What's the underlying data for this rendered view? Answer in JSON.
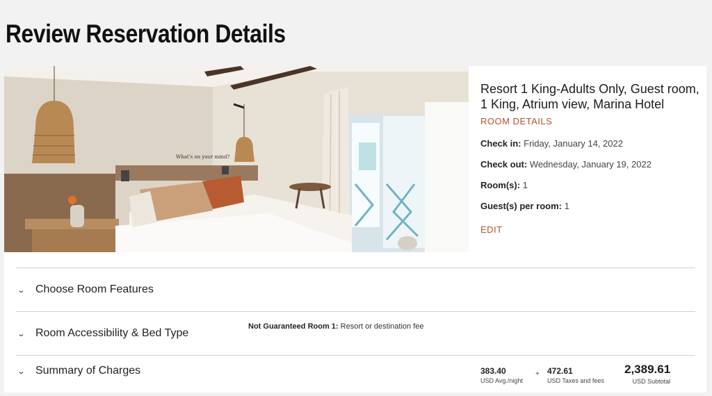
{
  "page": {
    "title": "Review Reservation Details"
  },
  "room": {
    "name": "Resort 1 King-Adults Only, Guest room, 1 King, Atrium view, Marina Hotel",
    "details_link": "ROOM DETAILS",
    "check_in": {
      "label": "Check in:",
      "value": "Friday, January 14, 2022"
    },
    "check_out": {
      "label": "Check out:",
      "value": "Wednesday, January 19, 2022"
    },
    "rooms": {
      "label": "Room(s):",
      "value": "1"
    },
    "guests": {
      "label": "Guest(s) per room:",
      "value": "1"
    },
    "edit_link": "EDIT",
    "photo_wall_text": "What's on your mind?"
  },
  "sections": [
    {
      "label": "Choose Room Features"
    },
    {
      "label": "Room Accessibility & Bed Type"
    },
    {
      "label": "Summary of Charges"
    }
  ],
  "not_guaranteed": {
    "label": "Not Guaranteed Room 1:",
    "text": "Resort or destination fee"
  },
  "charges": {
    "avg_night": {
      "amount": "383.40",
      "label": "USD Avg./night"
    },
    "plus": "+",
    "taxes": {
      "amount": "472.61",
      "label": "USD Taxes and fees"
    },
    "subtotal": {
      "amount": "2,389.61",
      "label": "USD Subtotal"
    }
  },
  "colors": {
    "accent": "#b4532a",
    "background": "#f2f2f2",
    "card": "#ffffff"
  },
  "icons": {
    "chevron": "chevron-down-icon"
  }
}
